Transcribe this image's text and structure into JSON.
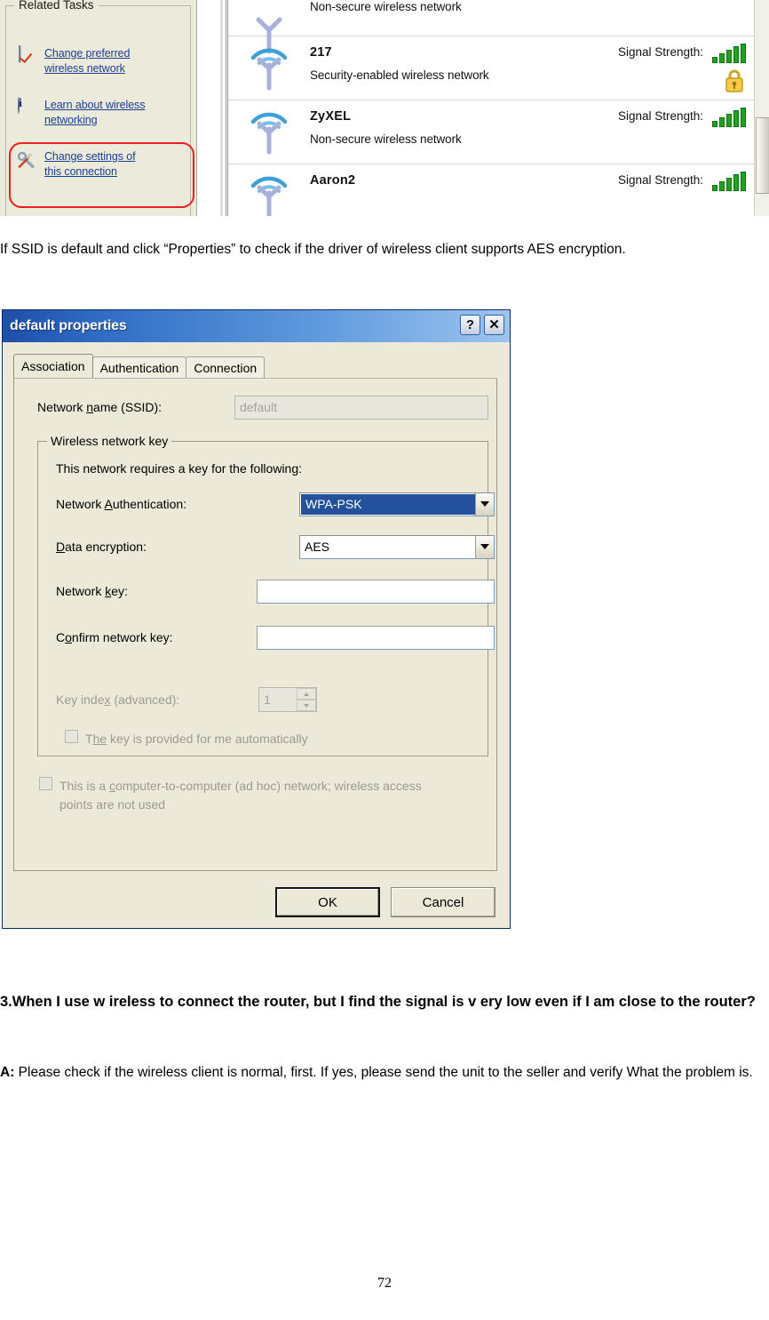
{
  "screenshot_top": {
    "related_tasks": {
      "title": "Related Tasks",
      "items": [
        {
          "label": "Change preferred wireless network ",
          "icon": "preferred-network-icon"
        },
        {
          "label": "Learn about wireless networking",
          "icon": "info-icon"
        },
        {
          "label": "Change settings of this connection",
          "icon": "tools-icon",
          "highlighted": true
        }
      ],
      "highlight_color": "#ef1d1d"
    },
    "network_list": {
      "signal_label": "Signal Strength:",
      "rows": [
        {
          "name": "",
          "desc": "Non-secure wireless network",
          "partial": true,
          "show_signal": false,
          "secured": false
        },
        {
          "name": "217",
          "desc": "Security-enabled wireless network",
          "partial": false,
          "show_signal": true,
          "secured": true
        },
        {
          "name": "ZyXEL",
          "desc": "Non-secure wireless network",
          "partial": false,
          "show_signal": true,
          "secured": false
        },
        {
          "name": "Aaron2",
          "desc": "",
          "partial": false,
          "show_signal": true,
          "secured": false
        }
      ]
    }
  },
  "body": {
    "intro_paragraph": "If SSID is default and click “Properties” to check if the driver of wireless client supports AES encryption.",
    "question_heading": "3.When I use w ireless to connect the  router, but I find the  signal is v ery low even if I am close to the router?",
    "answer_lead": "A:",
    "answer_text": " Please check if the wireless client is normal, first. If yes, please send the unit to the seller and verify What the problem is.",
    "page_number": "72"
  },
  "dialog": {
    "title": "default properties",
    "titlebar_help_label": "?",
    "titlebar_close_label": "✕",
    "accent_color": "#23519c",
    "tabs": [
      {
        "label": "Association",
        "active": true
      },
      {
        "label": "Authentication",
        "active": false
      },
      {
        "label": "Connection",
        "active": false
      }
    ],
    "ssid": {
      "label_pre": "Network ",
      "label_mn": "n",
      "label_post": "ame (SSID):",
      "value": "default",
      "disabled": true
    },
    "key_group": {
      "caption": "Wireless network key",
      "description": "This network requires a key for the following:",
      "auth": {
        "label_pre": "Network ",
        "label_mn": "A",
        "label_post": "uthentication:",
        "value": "WPA-PSK",
        "selected": true
      },
      "encryption": {
        "label_mn": "D",
        "label_post": "ata encryption:",
        "value": "AES",
        "selected": false
      },
      "network_key": {
        "label_pre": "Network ",
        "label_mn": "k",
        "label_post": "ey:",
        "value": ""
      },
      "confirm_key": {
        "label_pre": "C",
        "label_mn": "o",
        "label_post": "nfirm network key:",
        "value": ""
      },
      "key_index": {
        "label_pre": "Key inde",
        "label_mn": "x",
        "label_post": " (advanced):",
        "value": "1",
        "disabled": true
      },
      "auto_key_checkbox": {
        "label_pre": "T",
        "label_mn": "he",
        "label_post": " key is provided for me automatically",
        "checked": false,
        "disabled": true
      }
    },
    "adhoc_checkbox": {
      "label_pre": "This is a ",
      "label_mn": "c",
      "label_post": "omputer-to-computer (ad hoc) network; wireless access points are not used",
      "checked": false,
      "disabled": true
    },
    "buttons": {
      "ok": "OK",
      "cancel": "Cancel"
    }
  }
}
